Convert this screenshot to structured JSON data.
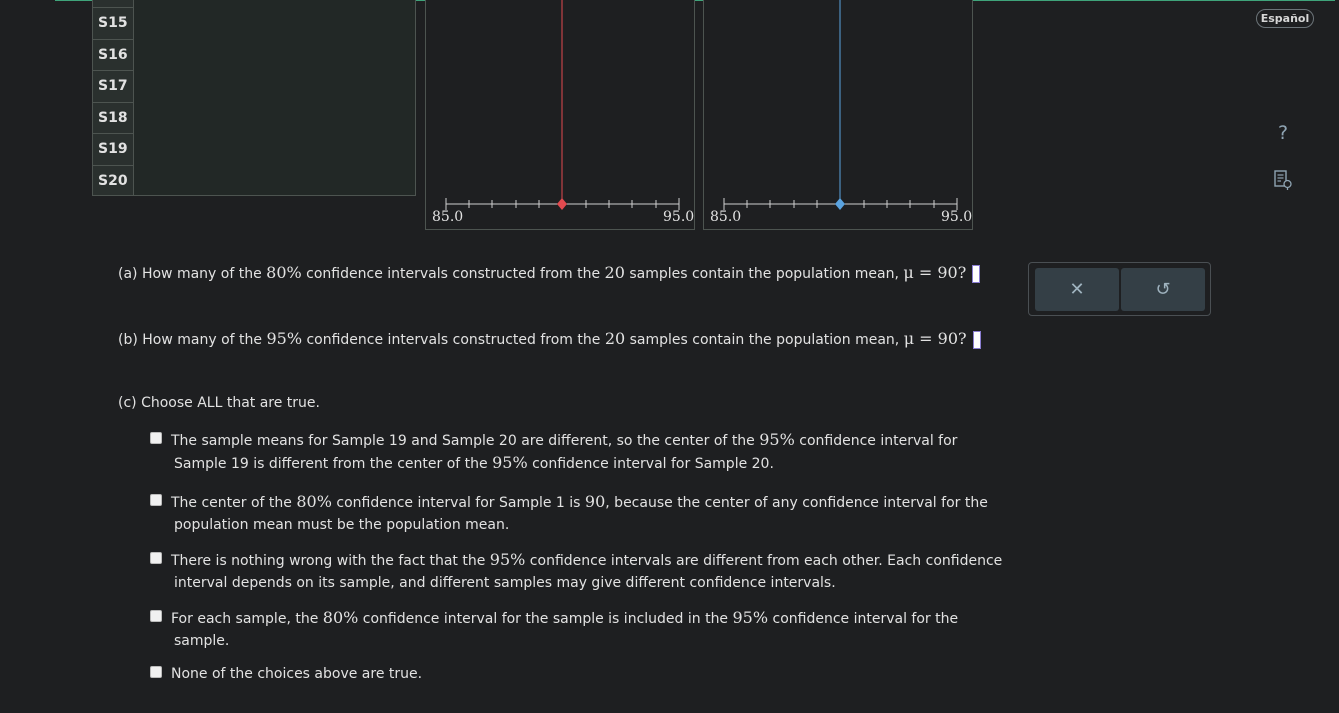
{
  "samples": [
    "S15",
    "S16",
    "S17",
    "S18",
    "S19",
    "S20"
  ],
  "plot80": {
    "axis_min": "85.0",
    "axis_max": "95.0",
    "line_color": "#e24a4f"
  },
  "plot95": {
    "axis_min": "85.0",
    "axis_max": "95.0",
    "line_color": "#5aa3e0"
  },
  "questions": {
    "a": {
      "prefix": "(a) How many of the ",
      "level": "80%",
      "mid": " confidence intervals constructed from the ",
      "n": "20",
      "suffix": " samples contain the population mean, ",
      "mu": "μ = 90?"
    },
    "b": {
      "prefix": "(b) How many of the ",
      "level": "95%",
      "mid": " confidence intervals constructed from the ",
      "n": "20",
      "suffix": " samples contain the population mean, ",
      "mu": "μ = 90?"
    }
  },
  "part_c": {
    "title": "(c) Choose ALL that are true.",
    "choices": [
      {
        "l1a": "The sample means for Sample 19 and Sample 20 are different, so the center of the ",
        "l1n": "95%",
        "l1b": " confidence interval for",
        "l2a": "Sample 19 is different from the center of the ",
        "l2n": "95%",
        "l2b": " confidence interval for Sample 20."
      },
      {
        "l1a": "The center of the ",
        "l1n": "80%",
        "l1b": " confidence interval for Sample 1 is ",
        "l1n2": "90",
        "l1c": ", because the center of any confidence interval for the",
        "l2a": "population mean must be the population mean."
      },
      {
        "l1a": "There is nothing wrong with the fact that the ",
        "l1n": "95%",
        "l1b": " confidence intervals are different from each other. Each confidence",
        "l2a": "interval depends on its sample, and different samples may give different confidence intervals."
      },
      {
        "l1a": "For each sample, the ",
        "l1n": "80%",
        "l1b": " confidence interval for the sample is included in the ",
        "l1n2": "95%",
        "l1c": " confidence interval for the",
        "l2a": "sample."
      },
      {
        "l1a": "None of the choices above are true."
      }
    ]
  },
  "keypad": {
    "clear_icon": "✕",
    "undo_icon": "↺"
  },
  "sidebar": {
    "language": "Español",
    "help_icon": "?",
    "notes_icon": "notes-icon"
  }
}
